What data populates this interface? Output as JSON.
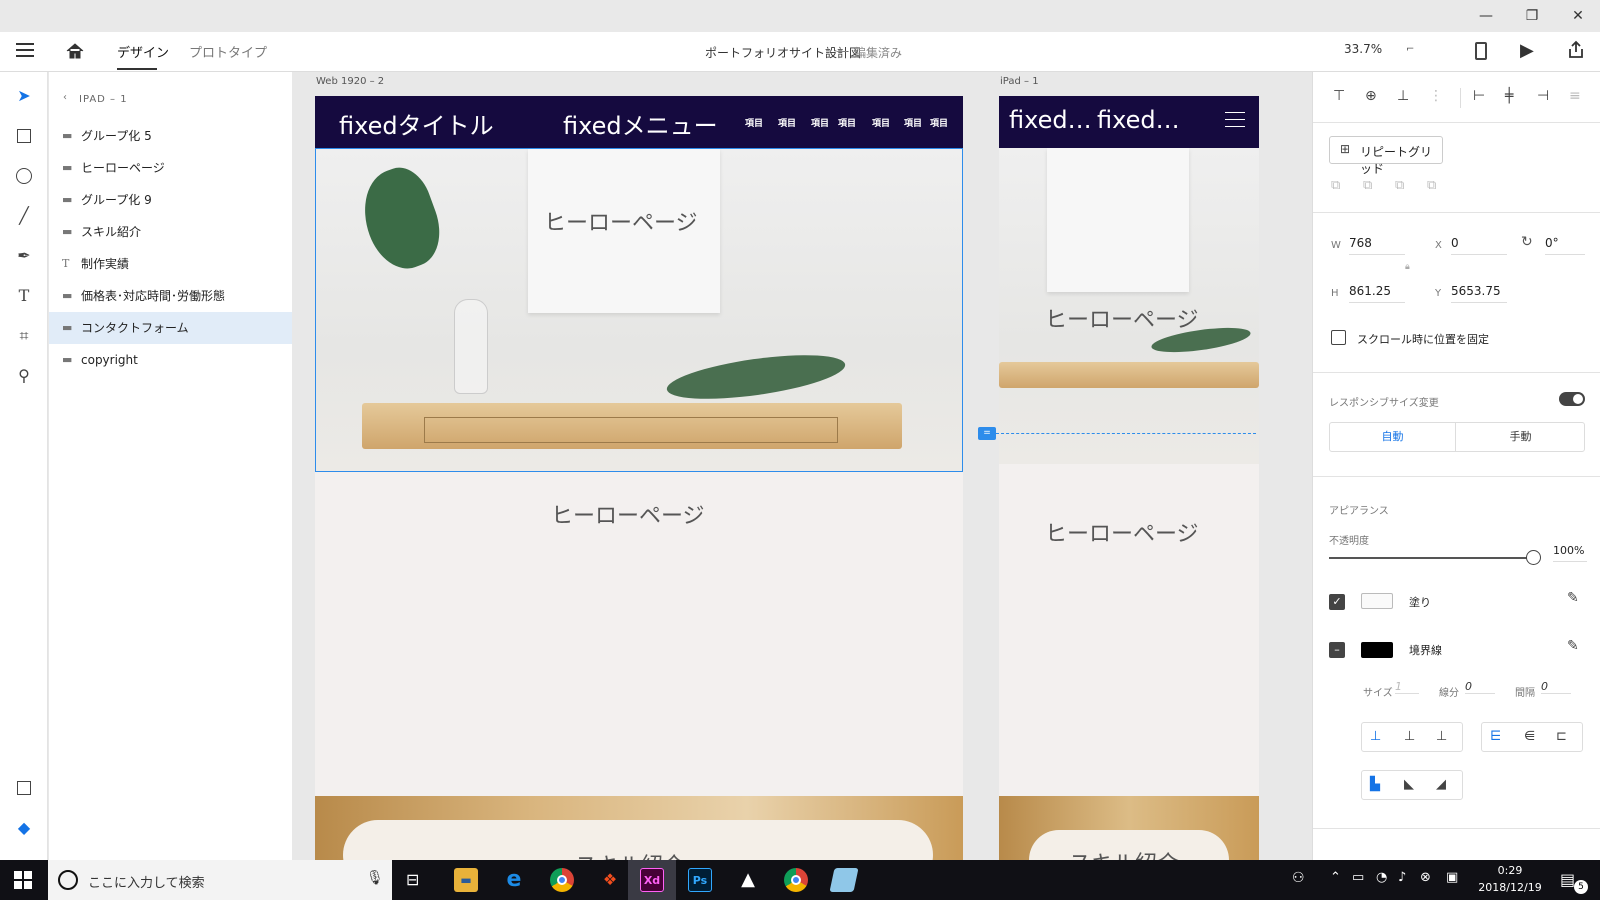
{
  "window": {
    "minimize": "—",
    "maximize": "❐",
    "close": "✕"
  },
  "appbar": {
    "tabs": [
      "デザイン",
      "プロトタイプ"
    ],
    "document_title": "ポートフォリオサイト設計図",
    "document_status": "編集済み",
    "separator": "—",
    "zoom": "33.7%"
  },
  "layers_panel": {
    "back_label": "IPAD – 1",
    "items": [
      {
        "label": "グループ化 5",
        "icon": "folder-icon"
      },
      {
        "label": "ヒーローページ",
        "icon": "folder-icon"
      },
      {
        "label": "グループ化 9",
        "icon": "folder-icon"
      },
      {
        "label": "スキル紹介",
        "icon": "folder-icon"
      },
      {
        "label": "制作実績",
        "icon": "text-icon"
      },
      {
        "label": "価格表･対応時間･労働形態",
        "icon": "folder-icon"
      },
      {
        "label": "コンタクトフォーム",
        "icon": "folder-icon",
        "selected": true
      },
      {
        "label": "copyright",
        "icon": "folder-icon"
      }
    ]
  },
  "canvas": {
    "artboard_web": {
      "name": "Web 1920 – 2",
      "title": "fixedタイトル",
      "menu": "fixedメニュー",
      "items": [
        "項目",
        "項目",
        "項目",
        "項目",
        "項目",
        "項目",
        "項目"
      ],
      "hero_label": "ヒーローページ",
      "hero_label2": "ヒーローページ",
      "skill_label": "スキル紹介"
    },
    "artboard_ipad": {
      "name": "iPad – 1",
      "title": "fixed…",
      "menu": "fixed…",
      "hero_label": "ヒーローページ",
      "hero_label2": "ヒーローページ",
      "skill_label": "スキル紹介"
    },
    "header_color": "#150a3f"
  },
  "properties": {
    "repeat_grid": "リピートグリッド",
    "w_label": "W",
    "w": "768",
    "h_label": "H",
    "h": "861.25",
    "x_label": "X",
    "x": "0",
    "y_label": "Y",
    "y": "5653.75",
    "rotation": "0°",
    "fix_on_scroll": "スクロール時に位置を固定",
    "responsive_resize": "レスポンシブサイズ変更",
    "auto": "自動",
    "manual": "手動",
    "appearance": "アピアランス",
    "opacity_label": "不透明度",
    "opacity": "100%",
    "opacity_value": 1.0,
    "fill": "塗り",
    "border": "境界線",
    "size_label": "サイズ",
    "size_value": "1",
    "dash_label": "線分",
    "dash_value": "0",
    "gap_label": "間隔",
    "gap_value": "0",
    "accent_color": "#1473e6"
  },
  "taskbar": {
    "search_placeholder": "ここに入力して検索",
    "time": "0:29",
    "date": "2018/12/19",
    "notifications": "5",
    "apps": [
      "file-explorer-icon",
      "edge-icon",
      "chrome-icon",
      "figma-icon",
      "xd-icon",
      "photoshop-icon",
      "onigiri-icon",
      "chrome-icon",
      "app-icon"
    ]
  }
}
